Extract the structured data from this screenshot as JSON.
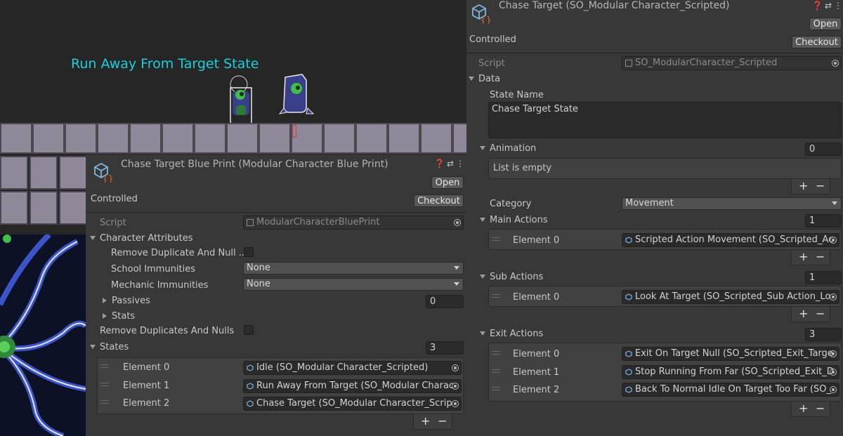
{
  "scene": {
    "title": "Run Away From Target State"
  },
  "blueprint": {
    "title": "Chase Target Blue Print (Modular Character Blue Print)",
    "open_label": "Open",
    "controlled_label": "Controlled",
    "checkout_label": "Checkout",
    "script_label": "Script",
    "script_value": "ModularCharacterBluePrint",
    "character_attributes_label": "Character Attributes",
    "remove_dup_null_label": "Remove Duplicate And Null ...",
    "school_immunities_label": "School Immunities",
    "school_immunities_value": "None",
    "mechanic_immunities_label": "Mechanic Immunities",
    "mechanic_immunities_value": "None",
    "passives_label": "Passives",
    "passives_count": "0",
    "stats_label": "Stats",
    "remove_duplicates_label": "Remove Duplicates And Nulls",
    "states_label": "States",
    "states_count": "3",
    "states": [
      {
        "label": "Element 0",
        "value": "Idle (SO_Modular Character_Scripted)"
      },
      {
        "label": "Element 1",
        "value": "Run Away From Target (SO_Modular Charac"
      },
      {
        "label": "Element 2",
        "value": "Chase Target (SO_Modular Character_Scrip"
      }
    ],
    "plus": "+",
    "minus": "−"
  },
  "chase": {
    "title": "Chase Target (SO_Modular Character_Scripted)",
    "open_label": "Open",
    "controlled_label": "Controlled",
    "checkout_label": "Checkout",
    "script_label": "Script",
    "script_value": "SO_ModularCharacter_Scripted",
    "data_label": "Data",
    "state_name_label": "State Name",
    "state_name_value": "Chase Target State",
    "animation_label": "Animation",
    "animation_count": "0",
    "list_empty": "List is empty",
    "category_label": "Category",
    "category_value": "Movement",
    "main_actions_label": "Main Actions",
    "main_actions_count": "1",
    "main_actions": [
      {
        "label": "Element 0",
        "value": "Scripted Action Movement (SO_Scripted_Ac"
      }
    ],
    "sub_actions_label": "Sub Actions",
    "sub_actions_count": "1",
    "sub_actions": [
      {
        "label": "Element 0",
        "value": "Look At Target (SO_Scripted_Sub Action_Lo"
      }
    ],
    "exit_actions_label": "Exit Actions",
    "exit_actions_count": "3",
    "exit_actions": [
      {
        "label": "Element 0",
        "value": "Exit On Target Null (SO_Scripted_Exit_Targe"
      },
      {
        "label": "Element 1",
        "value": "Stop Running From Far (SO_Scripted_Exit_D"
      },
      {
        "label": "Element 2",
        "value": "Back To Normal Idle On Target Too Far (SO_"
      }
    ],
    "plus": "+",
    "minus": "−"
  },
  "colors": {
    "scene_title": "#19d0dc",
    "panel_bg": "#383838",
    "tile": "#8f8898",
    "script_icon_orange": "#e0622a",
    "script_icon_blue": "#7fb7e6"
  }
}
